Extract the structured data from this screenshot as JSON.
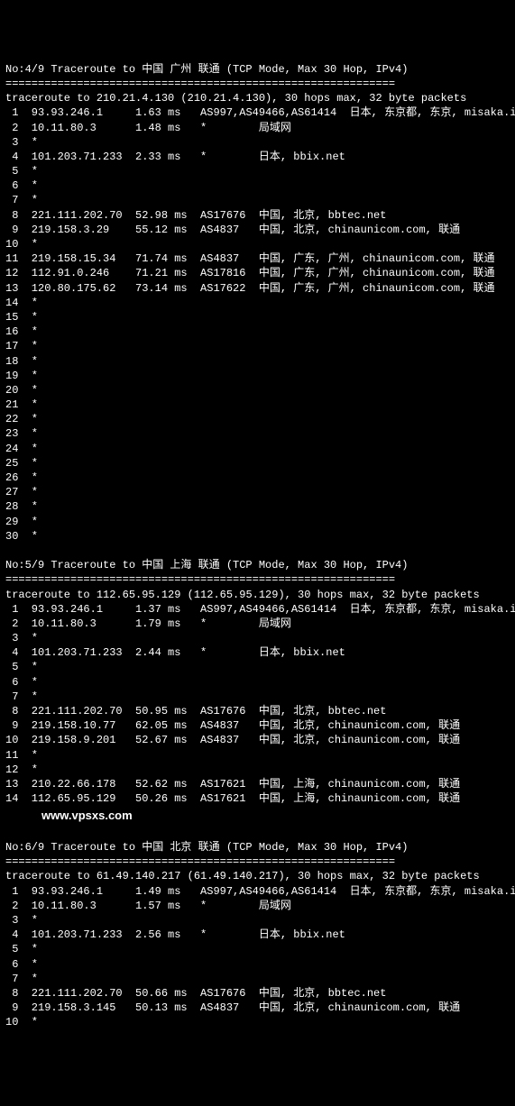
{
  "watermark": "www.vpsxs.com",
  "sections": [
    {
      "no": "4/9",
      "title": "No:4/9 Traceroute to 中国 广州 联通 (TCP Mode, Max 30 Hop, IPv4)",
      "divider": "============================================================",
      "trace_header": "traceroute to 210.21.4.130 (210.21.4.130), 30 hops max, 32 byte packets",
      "hops": [
        {
          "n": 1,
          "ip": "93.93.246.1",
          "ms": "1.63 ms",
          "asn": "AS997,AS49466,AS61414",
          "loc": "日本, 东京都, 东京, misaka.io"
        },
        {
          "n": 2,
          "ip": "10.11.80.3",
          "ms": "1.48 ms",
          "asn": "*",
          "loc": "局域网"
        },
        {
          "n": 3,
          "ip": "*"
        },
        {
          "n": 4,
          "ip": "101.203.71.233",
          "ms": "2.33 ms",
          "asn": "*",
          "loc": "日本, bbix.net"
        },
        {
          "n": 5,
          "ip": "*"
        },
        {
          "n": 6,
          "ip": "*"
        },
        {
          "n": 7,
          "ip": "*"
        },
        {
          "n": 8,
          "ip": "221.111.202.70",
          "ms": "52.98 ms",
          "asn": "AS17676",
          "loc": "中国, 北京, bbtec.net"
        },
        {
          "n": 9,
          "ip": "219.158.3.29",
          "ms": "55.12 ms",
          "asn": "AS4837",
          "loc": "中国, 北京, chinaunicom.com, 联通"
        },
        {
          "n": 10,
          "ip": "*"
        },
        {
          "n": 11,
          "ip": "219.158.15.34",
          "ms": "71.74 ms",
          "asn": "AS4837",
          "loc": "中国, 广东, 广州, chinaunicom.com, 联通"
        },
        {
          "n": 12,
          "ip": "112.91.0.246",
          "ms": "71.21 ms",
          "asn": "AS17816",
          "loc": "中国, 广东, 广州, chinaunicom.com, 联通"
        },
        {
          "n": 13,
          "ip": "120.80.175.62",
          "ms": "73.14 ms",
          "asn": "AS17622",
          "loc": "中国, 广东, 广州, chinaunicom.com, 联通"
        },
        {
          "n": 14,
          "ip": "*"
        },
        {
          "n": 15,
          "ip": "*"
        },
        {
          "n": 16,
          "ip": "*"
        },
        {
          "n": 17,
          "ip": "*"
        },
        {
          "n": 18,
          "ip": "*"
        },
        {
          "n": 19,
          "ip": "*"
        },
        {
          "n": 20,
          "ip": "*"
        },
        {
          "n": 21,
          "ip": "*"
        },
        {
          "n": 22,
          "ip": "*"
        },
        {
          "n": 23,
          "ip": "*"
        },
        {
          "n": 24,
          "ip": "*"
        },
        {
          "n": 25,
          "ip": "*"
        },
        {
          "n": 26,
          "ip": "*"
        },
        {
          "n": 27,
          "ip": "*"
        },
        {
          "n": 28,
          "ip": "*"
        },
        {
          "n": 29,
          "ip": "*"
        },
        {
          "n": 30,
          "ip": "*"
        }
      ]
    },
    {
      "no": "5/9",
      "title": "No:5/9 Traceroute to 中国 上海 联通 (TCP Mode, Max 30 Hop, IPv4)",
      "divider": "============================================================",
      "trace_header": "traceroute to 112.65.95.129 (112.65.95.129), 30 hops max, 32 byte packets",
      "hops": [
        {
          "n": 1,
          "ip": "93.93.246.1",
          "ms": "1.37 ms",
          "asn": "AS997,AS49466,AS61414",
          "loc": "日本, 东京都, 东京, misaka.io"
        },
        {
          "n": 2,
          "ip": "10.11.80.3",
          "ms": "1.79 ms",
          "asn": "*",
          "loc": "局域网"
        },
        {
          "n": 3,
          "ip": "*"
        },
        {
          "n": 4,
          "ip": "101.203.71.233",
          "ms": "2.44 ms",
          "asn": "*",
          "loc": "日本, bbix.net"
        },
        {
          "n": 5,
          "ip": "*"
        },
        {
          "n": 6,
          "ip": "*"
        },
        {
          "n": 7,
          "ip": "*"
        },
        {
          "n": 8,
          "ip": "221.111.202.70",
          "ms": "50.95 ms",
          "asn": "AS17676",
          "loc": "中国, 北京, bbtec.net"
        },
        {
          "n": 9,
          "ip": "219.158.10.77",
          "ms": "62.05 ms",
          "asn": "AS4837",
          "loc": "中国, 北京, chinaunicom.com, 联通"
        },
        {
          "n": 10,
          "ip": "219.158.9.201",
          "ms": "52.67 ms",
          "asn": "AS4837",
          "loc": "中国, 北京, chinaunicom.com, 联通"
        },
        {
          "n": 11,
          "ip": "*"
        },
        {
          "n": 12,
          "ip": "*"
        },
        {
          "n": 13,
          "ip": "210.22.66.178",
          "ms": "52.62 ms",
          "asn": "AS17621",
          "loc": "中国, 上海, chinaunicom.com, 联通"
        },
        {
          "n": 14,
          "ip": "112.65.95.129",
          "ms": "50.26 ms",
          "asn": "AS17621",
          "loc": "中国, 上海, chinaunicom.com, 联通"
        }
      ]
    },
    {
      "no": "6/9",
      "title": "No:6/9 Traceroute to 中国 北京 联通 (TCP Mode, Max 30 Hop, IPv4)",
      "divider": "============================================================",
      "trace_header": "traceroute to 61.49.140.217 (61.49.140.217), 30 hops max, 32 byte packets",
      "hops": [
        {
          "n": 1,
          "ip": "93.93.246.1",
          "ms": "1.49 ms",
          "asn": "AS997,AS49466,AS61414",
          "loc": "日本, 东京都, 东京, misaka.io"
        },
        {
          "n": 2,
          "ip": "10.11.80.3",
          "ms": "1.57 ms",
          "asn": "*",
          "loc": "局域网"
        },
        {
          "n": 3,
          "ip": "*"
        },
        {
          "n": 4,
          "ip": "101.203.71.233",
          "ms": "2.56 ms",
          "asn": "*",
          "loc": "日本, bbix.net"
        },
        {
          "n": 5,
          "ip": "*"
        },
        {
          "n": 6,
          "ip": "*"
        },
        {
          "n": 7,
          "ip": "*"
        },
        {
          "n": 8,
          "ip": "221.111.202.70",
          "ms": "50.66 ms",
          "asn": "AS17676",
          "loc": "中国, 北京, bbtec.net"
        },
        {
          "n": 9,
          "ip": "219.158.3.145",
          "ms": "50.13 ms",
          "asn": "AS4837",
          "loc": "中国, 北京, chinaunicom.com, 联通"
        },
        {
          "n": 10,
          "ip": "*",
          "partial": true
        }
      ]
    }
  ]
}
